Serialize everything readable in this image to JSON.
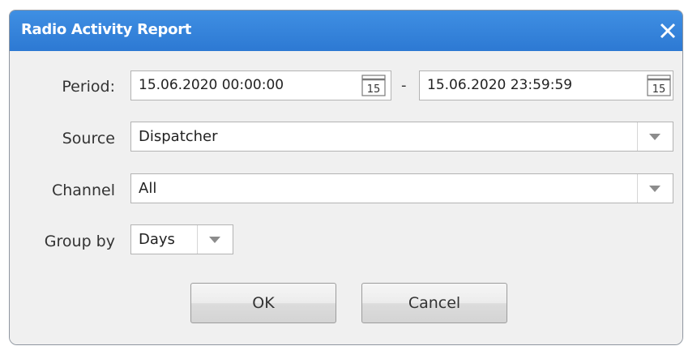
{
  "dialog": {
    "title": "Radio Activity Report",
    "close_icon": "close-icon",
    "accent_color": "#3584dc"
  },
  "form": {
    "period": {
      "label": "Period:",
      "start": "15.06.2020 00:00:00",
      "separator": "-",
      "end": "15.06.2020 23:59:59",
      "calendar_icon_text": "15"
    },
    "source": {
      "label": "Source",
      "value": "Dispatcher"
    },
    "channel": {
      "label": "Channel",
      "value": "All"
    },
    "group_by": {
      "label": "Group by",
      "value": "Days"
    }
  },
  "buttons": {
    "ok": "OK",
    "cancel": "Cancel"
  }
}
